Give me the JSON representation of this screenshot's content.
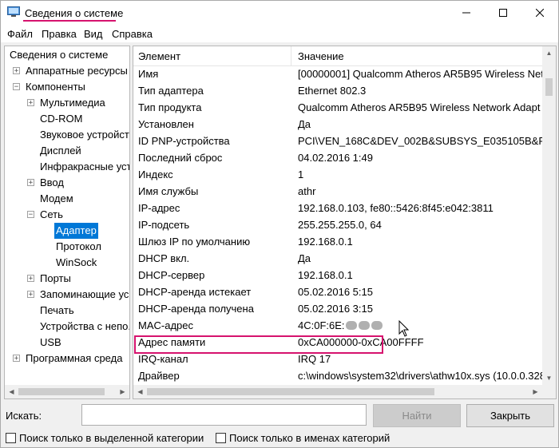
{
  "window": {
    "title": "Сведения о системе",
    "accent_color": "#d6136e"
  },
  "menubar": {
    "items": [
      "Файл",
      "Правка",
      "Вид",
      "Справка"
    ]
  },
  "tree": {
    "items": [
      {
        "label": "Сведения о системе",
        "level": 0,
        "toggle": ""
      },
      {
        "label": "Аппаратные ресурсы",
        "level": 1,
        "toggle": "+"
      },
      {
        "label": "Компоненты",
        "level": 1,
        "toggle": "−"
      },
      {
        "label": "Мультимедиа",
        "level": 2,
        "toggle": "+"
      },
      {
        "label": "CD-ROM",
        "level": 2,
        "toggle": ""
      },
      {
        "label": "Звуковое устройст",
        "level": 2,
        "toggle": ""
      },
      {
        "label": "Дисплей",
        "level": 2,
        "toggle": ""
      },
      {
        "label": "Инфракрасные уст",
        "level": 2,
        "toggle": ""
      },
      {
        "label": "Ввод",
        "level": 2,
        "toggle": "+"
      },
      {
        "label": "Модем",
        "level": 2,
        "toggle": ""
      },
      {
        "label": "Сеть",
        "level": 2,
        "toggle": "−"
      },
      {
        "label": "Адаптер",
        "level": 3,
        "toggle": "",
        "selected": true
      },
      {
        "label": "Протокол",
        "level": 3,
        "toggle": ""
      },
      {
        "label": "WinSock",
        "level": 3,
        "toggle": ""
      },
      {
        "label": "Порты",
        "level": 2,
        "toggle": "+"
      },
      {
        "label": "Запоминающие ус",
        "level": 2,
        "toggle": "+"
      },
      {
        "label": "Печать",
        "level": 2,
        "toggle": ""
      },
      {
        "label": "Устройства с непо.",
        "level": 2,
        "toggle": ""
      },
      {
        "label": "USB",
        "level": 2,
        "toggle": ""
      },
      {
        "label": "Программная среда",
        "level": 1,
        "toggle": "+"
      }
    ]
  },
  "list": {
    "headers": {
      "name": "Элемент",
      "value": "Значение"
    },
    "rows": [
      {
        "name": "Имя",
        "value": "[00000001] Qualcomm Atheros AR5B95 Wireless Net"
      },
      {
        "name": "Тип адаптера",
        "value": "Ethernet 802.3"
      },
      {
        "name": "Тип продукта",
        "value": "Qualcomm Atheros AR5B95 Wireless Network Adapt"
      },
      {
        "name": "Установлен",
        "value": "Да"
      },
      {
        "name": "ID PNP-устройства",
        "value": "PCI\\VEN_168C&DEV_002B&SUBSYS_E035105B&REV_("
      },
      {
        "name": "Последний сброс",
        "value": "04.02.2016 1:49"
      },
      {
        "name": "Индекс",
        "value": "1"
      },
      {
        "name": "Имя службы",
        "value": "athr"
      },
      {
        "name": "IP-адрес",
        "value": "192.168.0.103, fe80::5426:8f45:e042:3811"
      },
      {
        "name": "IP-подсеть",
        "value": "255.255.255.0, 64"
      },
      {
        "name": "Шлюз IP по умолчанию",
        "value": "192.168.0.1"
      },
      {
        "name": "DHCP вкл.",
        "value": "Да"
      },
      {
        "name": "DHCP-сервер",
        "value": "192.168.0.1"
      },
      {
        "name": "DHCP-аренда истекает",
        "value": "05.02.2016 5:15"
      },
      {
        "name": "DHCP-аренда получена",
        "value": "05.02.2016 3:15"
      },
      {
        "name": "MAC-адрес",
        "value": "4C:0F:6E:",
        "redacted": true
      },
      {
        "name": "Адрес памяти",
        "value": "0xCA000000-0xCA00FFFF"
      },
      {
        "name": "IRQ-канал",
        "value": "IRQ 17"
      },
      {
        "name": "Драйвер",
        "value": "c:\\windows\\system32\\drivers\\athw10x.sys (10.0.0.328"
      }
    ]
  },
  "search": {
    "label": "Искать:",
    "input_value": "",
    "find_button": "Найти",
    "close_button": "Закрыть",
    "option_selected_category": "Поиск только в выделенной категории",
    "option_category_names": "Поиск только в именах категорий"
  }
}
